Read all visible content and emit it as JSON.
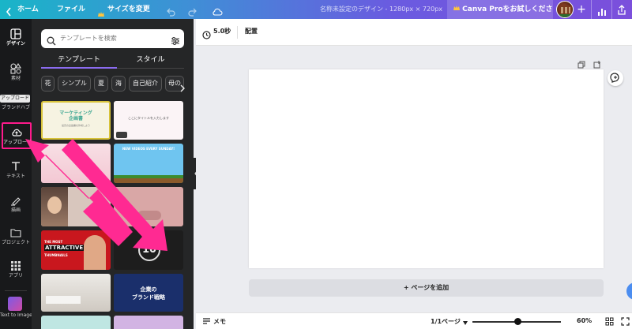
{
  "topbar": {
    "home": "ホーム",
    "file": "ファイル",
    "resize": "サイズを変更",
    "doc_title": "名称未設定のデザイン - 1280px × 720px",
    "trial": "Canva Proをお試しください"
  },
  "rail": {
    "items": [
      {
        "label": "デザイン",
        "icon": "layout-icon"
      },
      {
        "label": "素材",
        "icon": "shapes-icon"
      },
      {
        "label": "ブランドハブ",
        "icon": "brand-icon"
      },
      {
        "label": "アップロード",
        "icon": "cloud-upload-icon"
      },
      {
        "label": "テキスト",
        "icon": "text-icon"
      },
      {
        "label": "描画",
        "icon": "draw-icon"
      },
      {
        "label": "プロジェクト",
        "icon": "folder-icon"
      },
      {
        "label": "アプリ",
        "icon": "apps-grid-icon"
      },
      {
        "label": "Text to Image",
        "icon": "ai-image-icon"
      }
    ],
    "tooltip": "アップロード"
  },
  "panel": {
    "search_placeholder": "テンプレートを検索",
    "tabs": [
      "テンプレート",
      "スタイル"
    ],
    "chips": [
      "花",
      "シンプル",
      "夏",
      "海",
      "自己紹介",
      "母の"
    ],
    "thumbs": {
      "t1_title": "マーケティング\n企画書",
      "t1_sub": "最高の企画書を作成しよう",
      "t2_text": "ここにタイトルを入力します",
      "t3_text": "NEW VIDEOS EVERY SUNDAY!",
      "t6_line1": "THE MOST",
      "t6_line2": "ATTRACTIVE",
      "t6_line3": "THUMBNAILS",
      "t7_text": "10",
      "t9_line1": "企業の",
      "t9_line2": "ブランド戦略"
    }
  },
  "toolbar": {
    "duration": "5.0秒",
    "arrange": "配置"
  },
  "canvas": {
    "add_page": "+ ページを追加"
  },
  "bottom": {
    "notes": "メモ",
    "page_count": "1/1ページ",
    "zoom": "60%"
  },
  "colors": {
    "accent_pink": "#ff1a8c",
    "rail_bg": "#18191b",
    "panel_bg": "#252627"
  }
}
